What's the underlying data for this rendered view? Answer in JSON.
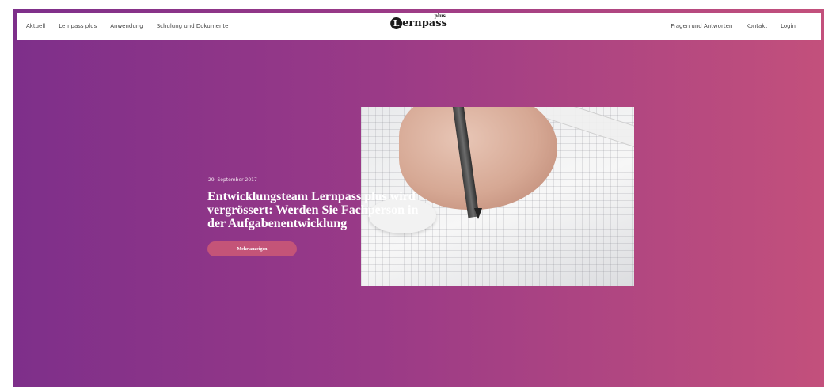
{
  "nav": {
    "left": [
      "Aktuell",
      "Lernpass plus",
      "Anwendung",
      "Schulung und Dokumente"
    ],
    "right": [
      "Fragen und Antworten",
      "Kontakt",
      "Login"
    ]
  },
  "logo": {
    "initial": "L",
    "word": "ernpass",
    "plus": "plus"
  },
  "hero": {
    "date": "29. September 2017",
    "headline": "Entwicklungsteam Lernpass plus wird vergrössert: Werden Sie Fachperson in der Aufgabenentwicklung",
    "button": "Mehr anzeigen"
  },
  "colors": {
    "gradient_start": "#7e2f8a",
    "gradient_end": "#c3507c",
    "button": "#c45478"
  }
}
